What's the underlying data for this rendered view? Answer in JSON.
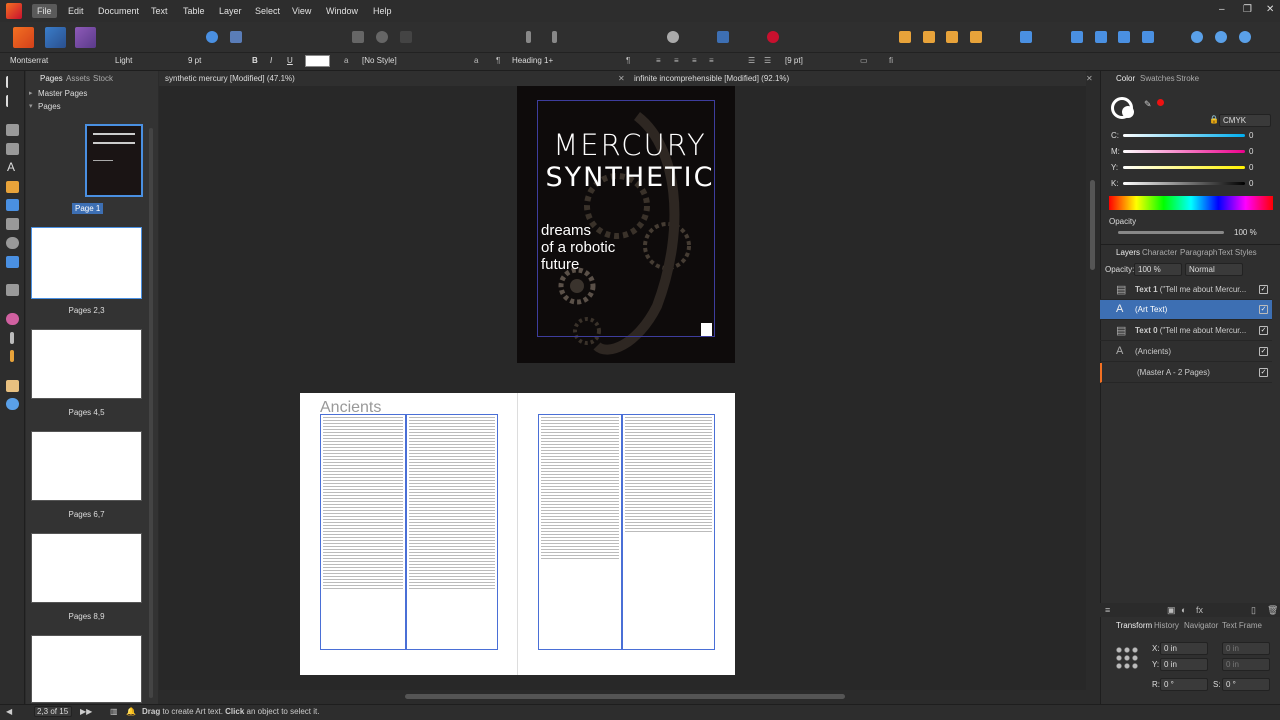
{
  "menu": [
    "File",
    "Edit",
    "Document",
    "Text",
    "Table",
    "Layer",
    "Select",
    "View",
    "Window",
    "Help"
  ],
  "context": {
    "font": "Montserrat",
    "weight": "Light",
    "size": "9 pt",
    "bold": "B",
    "italic": "I",
    "underline": "U",
    "char_style": "[No Style]",
    "para_style": "Heading 1+",
    "spacing": "[9 pt]"
  },
  "left_panel": {
    "tabs": [
      "Pages",
      "Assets",
      "Stock"
    ],
    "sections": [
      "Master Pages",
      "Pages"
    ],
    "pages": [
      "Page 1",
      "Pages 2,3",
      "Pages 4,5",
      "Pages 6,7",
      "Pages 8,9"
    ]
  },
  "doc_tabs": [
    "synthetic mercury [Modified] (47.1%)",
    "infinite incomprehensible [Modified] (92.1%)"
  ],
  "cover": {
    "title_line1": "MERCURY",
    "title_line2": "SYNTHETIC",
    "subtitle_line1": "dreams",
    "subtitle_line2": "of a robotic",
    "subtitle_line3": "future"
  },
  "spread": {
    "heading": "Ancients"
  },
  "color_panel": {
    "tabs": [
      "Color",
      "Swatches",
      "Stroke"
    ],
    "model": "CMYK",
    "channels": [
      {
        "name": "C:",
        "value": "0",
        "color": "#00aeef"
      },
      {
        "name": "M:",
        "value": "0",
        "color": "#ec008c"
      },
      {
        "name": "Y:",
        "value": "0",
        "color": "#fff200"
      },
      {
        "name": "K:",
        "value": "0",
        "color": "#ffffff"
      }
    ],
    "opacity_label": "Opacity",
    "opacity": "100 %"
  },
  "layers_panel": {
    "tabs": [
      "Layers",
      "Character",
      "Paragraph",
      "Text Styles"
    ],
    "opacity_label": "Opacity:",
    "opacity": "100 %",
    "blend": "Normal",
    "items": [
      {
        "bold": "Text 1",
        "rest": "(\"Tell me about Mercur...",
        "icon": "text-frame",
        "selected": false
      },
      {
        "bold": "",
        "rest": "(Art Text)",
        "icon": "art-text",
        "selected": true
      },
      {
        "bold": "Text 0",
        "rest": "(\"Tell me about Mercur...",
        "icon": "text-frame",
        "selected": false
      },
      {
        "bold": "",
        "rest": "(Ancients)",
        "icon": "art-text",
        "selected": false
      },
      {
        "bold": "",
        "rest": "(Master A - 2 Pages)",
        "icon": "master",
        "selected": false
      }
    ]
  },
  "transform_panel": {
    "tabs": [
      "Transform",
      "History",
      "Navigator",
      "Text Frame"
    ],
    "x_label": "X:",
    "x": "0 in",
    "y_label": "Y:",
    "y": "0 in",
    "w": "0 in",
    "h": "0 in",
    "r_label": "R:",
    "r": "0 °",
    "s_label": "S:",
    "s": "0 °"
  },
  "status": {
    "pages": "2,3 of 15",
    "hint_b1": "Drag",
    "hint_t1": " to create Art text. ",
    "hint_b2": "Click",
    "hint_t2": " an object to select it."
  },
  "colors": {
    "accent": "#4a90e2",
    "selection": "#3d6fb3",
    "brand": "#f37022"
  }
}
